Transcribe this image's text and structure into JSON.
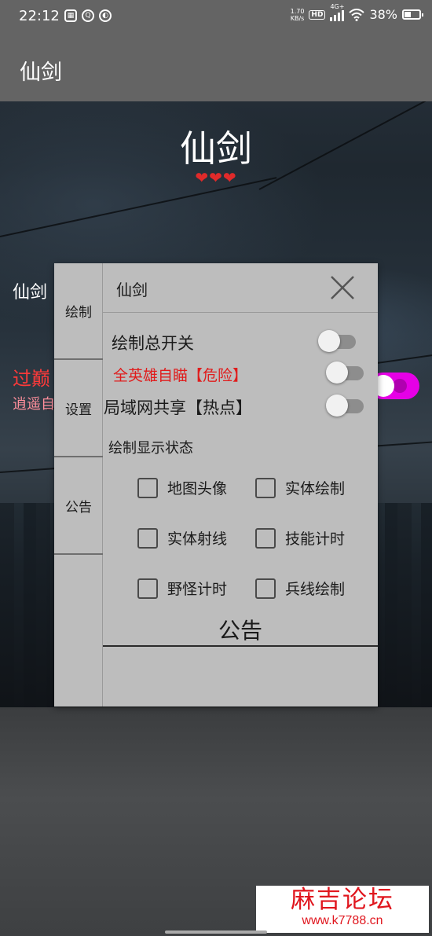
{
  "status_bar": {
    "time": "22:12",
    "net_speed_value": "1.70",
    "net_speed_unit": "KB/s",
    "hd": "HD",
    "network": "4G+",
    "battery": "38%",
    "battery_level": 0.38
  },
  "app_bar": {
    "title": "仙剑"
  },
  "hero": {
    "title": "仙剑",
    "hearts": "❤❤❤"
  },
  "background_labels": {
    "label1": "仙剑",
    "label2": "过巅",
    "label3": "逍遥自"
  },
  "panel": {
    "title": "仙剑",
    "tabs": [
      {
        "label": "绘制"
      },
      {
        "label": "设置"
      },
      {
        "label": "公告"
      }
    ],
    "switches": [
      {
        "label": "绘制总开关",
        "on": false
      },
      {
        "label": "全英雄自瞄【危险】",
        "on": false
      },
      {
        "label": "局域网共享【热点】",
        "on": false
      }
    ],
    "section_label": "绘制显示状态",
    "checkboxes": [
      {
        "label": "地图头像",
        "checked": false
      },
      {
        "label": "实体绘制",
        "checked": false
      },
      {
        "label": "实体射线",
        "checked": false
      },
      {
        "label": "技能计时",
        "checked": false
      },
      {
        "label": "野怪计时",
        "checked": false
      },
      {
        "label": "兵线绘制",
        "checked": false
      }
    ],
    "notice_heading": "公告"
  },
  "watermark": {
    "title": "麻吉论坛",
    "url": "www.k7788.cn"
  },
  "colors": {
    "bar": "#646464",
    "panel": "#bdbdbd",
    "danger": "#e01c1c",
    "toggle_on": "#e600e6"
  }
}
